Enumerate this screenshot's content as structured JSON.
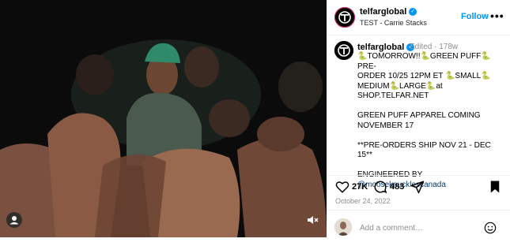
{
  "header": {
    "username": "telfarglobal",
    "subtitle": "TEST - Carrie Stacks",
    "follow_label": "Follow",
    "more_label": "•••"
  },
  "caption": {
    "username": "telfarglobal",
    "meta": "Edited · 178w",
    "lines": [
      "🐍TOMORROW!!🐍GREEN PUFF🐍PRE-",
      "ORDER 10/25 12PM ET 🐍SMALL🐍",
      "MEDIUM🐍LARGE🐍at",
      "SHOP.TELFAR.NET",
      "",
      "GREEN PUFF APPAREL COMING",
      "NOVEMBER 17",
      "",
      "**PRE-ORDERS SHIP NOV 21 - DEC 15**",
      "",
      "ENGINEERED BY"
    ],
    "mention": "@mooseknucklescanada"
  },
  "actions": {
    "likes": "27K",
    "comments": "483"
  },
  "date": "October 24, 2022",
  "comment": {
    "placeholder": "Add a comment…"
  },
  "icons": {
    "like": "heart-icon",
    "comment": "comment-icon",
    "share": "share-icon",
    "save": "bookmark-icon",
    "emoji": "emoji-icon",
    "mute": "mute-icon",
    "user": "user-icon"
  },
  "colors": {
    "accent": "#0095f6",
    "mention": "#00376b",
    "muted": "#8e8e8e"
  }
}
